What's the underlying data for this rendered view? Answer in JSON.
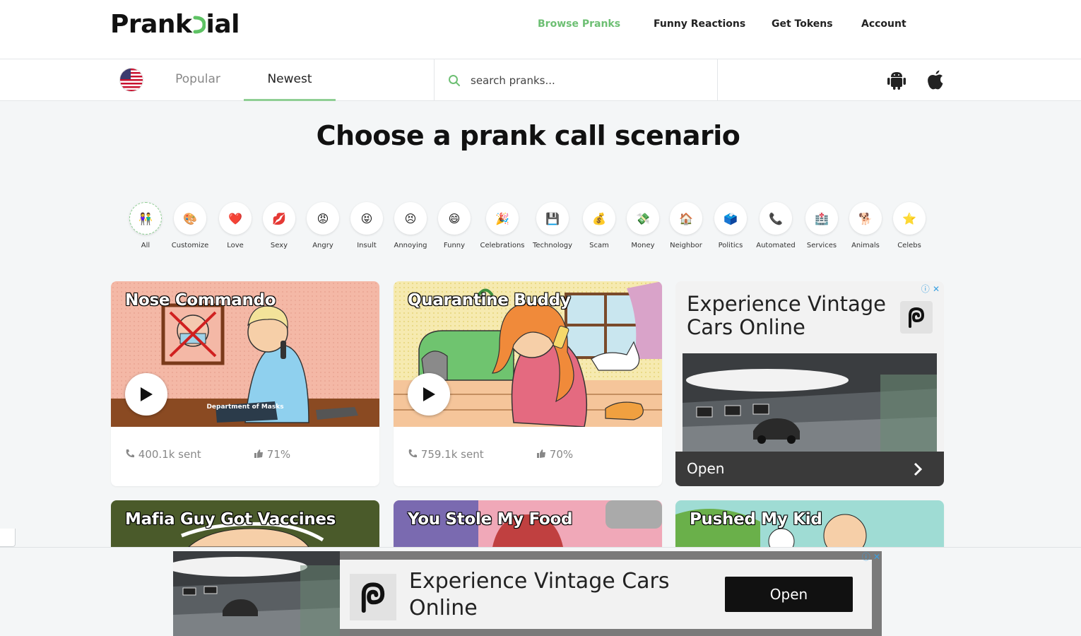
{
  "header": {
    "logo_left": "Prank",
    "logo_right": "ial",
    "nav": [
      {
        "label": "Browse Pranks",
        "active": true
      },
      {
        "label": "Funny Reactions"
      },
      {
        "label": "Get Tokens"
      },
      {
        "label": "Account"
      }
    ],
    "active_color": "#6dbf73"
  },
  "subbar": {
    "flag_icon": "us-flag-icon",
    "tabs": [
      {
        "label": "Popular"
      },
      {
        "label": "Newest",
        "active": true
      }
    ],
    "search_placeholder": "search pranks...",
    "os_icons": [
      "android-icon",
      "apple-icon"
    ]
  },
  "main": {
    "title": "Choose a prank call scenario",
    "categories": [
      {
        "label": "All",
        "icon": "👫",
        "selected": true
      },
      {
        "label": "Customize",
        "icon": "🎨"
      },
      {
        "label": "Love",
        "icon": "❤️"
      },
      {
        "label": "Sexy",
        "icon": "💋"
      },
      {
        "label": "Angry",
        "icon": "😡"
      },
      {
        "label": "Insult",
        "icon": "😝"
      },
      {
        "label": "Annoying",
        "icon": "😣"
      },
      {
        "label": "Funny",
        "icon": "😄"
      },
      {
        "label": "Celebrations",
        "icon": "🎉"
      },
      {
        "label": "Technology",
        "icon": "💾"
      },
      {
        "label": "Scam",
        "icon": "💰"
      },
      {
        "label": "Money",
        "icon": "💸"
      },
      {
        "label": "Neighbor",
        "icon": "🏠"
      },
      {
        "label": "Politics",
        "icon": "🗳️"
      },
      {
        "label": "Automated",
        "icon": "📞"
      },
      {
        "label": "Services",
        "icon": "🏥"
      },
      {
        "label": "Animals",
        "icon": "🐕"
      },
      {
        "label": "Celebs",
        "icon": "⭐"
      }
    ],
    "cards": [
      {
        "title": "Nose Commando",
        "sent": "400.1k sent",
        "rating": "71%",
        "sign": "Department of Masks"
      },
      {
        "title": "Quarantine Buddy",
        "sent": "759.1k sent",
        "rating": "70%"
      },
      {
        "title": "Mafia Guy Got Vaccines"
      },
      {
        "title": "You Stole My Food"
      },
      {
        "title": "Pushed My Kid"
      }
    ]
  },
  "ad_card": {
    "title": "Experience Vintage Cars Online",
    "cta": "Open"
  },
  "bottom_ad": {
    "title": "Experience Vintage Cars Online",
    "cta": "Open"
  }
}
